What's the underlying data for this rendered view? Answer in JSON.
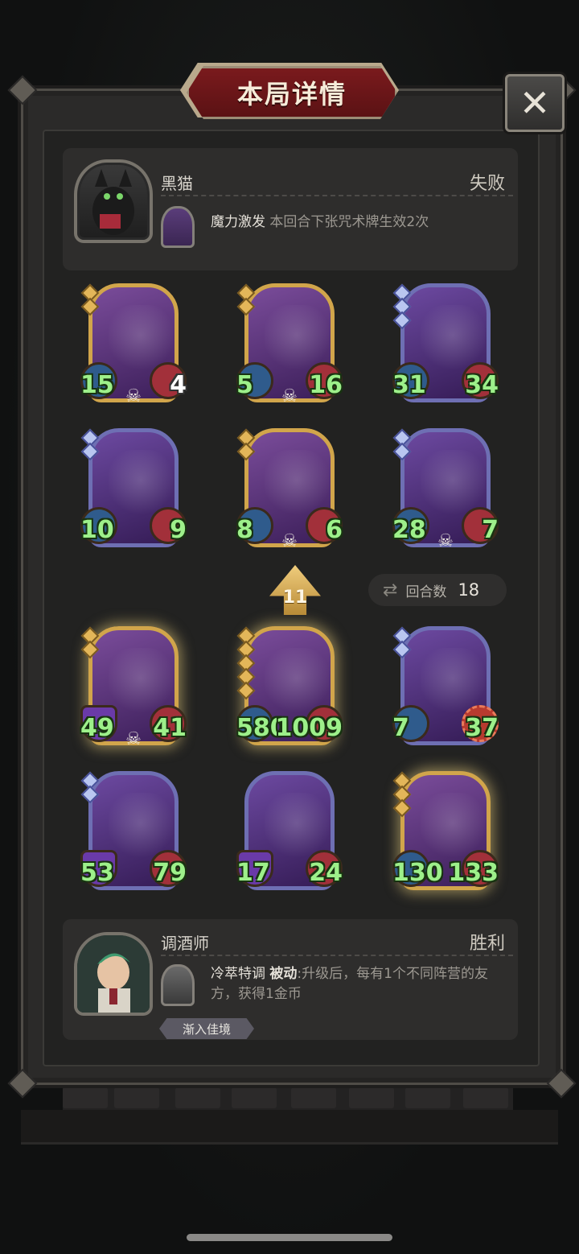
{
  "title": "本局详情",
  "close_label": "✕",
  "opponent": {
    "name": "黑猫",
    "result": "失败",
    "skill_name": "魔力激发",
    "skill_desc": "本回合下张咒术牌生效2次",
    "skill_icon": "spell-card-icon"
  },
  "opponent_cards": [
    {
      "attack": "15",
      "health": "4",
      "frame": "gold",
      "tier": 2,
      "dead": true
    },
    {
      "attack": "5",
      "health": "16",
      "frame": "gold",
      "tier": 2,
      "dead": true
    },
    {
      "attack": "31",
      "health": "34",
      "frame": "blue",
      "tier": 3,
      "dead": false
    },
    {
      "attack": "10",
      "health": "9",
      "frame": "blue",
      "tier": 2,
      "dead": false
    },
    {
      "attack": "8",
      "health": "6",
      "frame": "gold",
      "tier": 2,
      "dead": true
    },
    {
      "attack": "28",
      "health": "7",
      "frame": "blue",
      "tier": 2,
      "dead": true
    }
  ],
  "level": "11",
  "rounds": {
    "label": "回合数",
    "value": "18"
  },
  "player_cards": [
    {
      "attack": "49",
      "health": "41",
      "frame": "gold",
      "tier": 2,
      "dead": true,
      "glow": true
    },
    {
      "attack": "580",
      "health": "1009",
      "frame": "gold",
      "tier": 5,
      "dead": false,
      "glow": true
    },
    {
      "attack": "7",
      "health": "37",
      "frame": "blue",
      "tier": 2,
      "dead": false,
      "glow": false
    },
    {
      "attack": "53",
      "health": "79",
      "frame": "blue",
      "tier": 2,
      "dead": false,
      "glow": false
    },
    {
      "attack": "17",
      "health": "24",
      "frame": "blue",
      "tier": 0,
      "dead": false,
      "glow": false
    },
    {
      "attack": "130",
      "health": "133",
      "frame": "gold",
      "tier": 3,
      "dead": false,
      "glow": true
    }
  ],
  "player": {
    "name": "调酒师",
    "result": "胜利",
    "skill_name": "冷萃特调",
    "skill_type": "被动",
    "skill_desc": ":升级后，每有1个不同阵营的友方，获得1金币",
    "tag": "渐入佳境"
  }
}
